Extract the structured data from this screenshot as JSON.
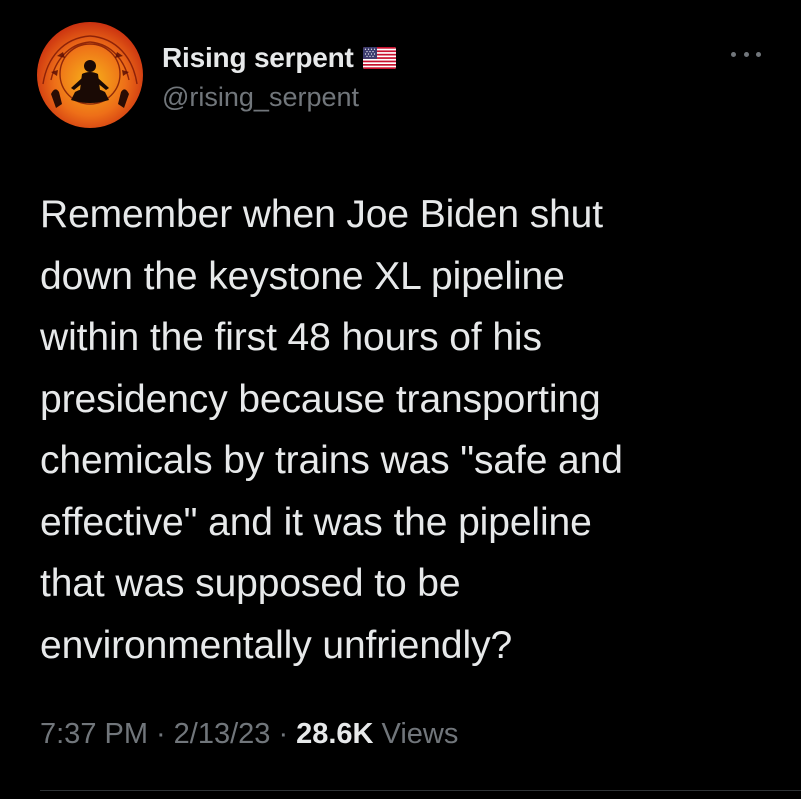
{
  "author": {
    "display_name": "Rising serpent",
    "handle": "@rising_serpent",
    "flag_icon": "us-flag-icon"
  },
  "tweet": {
    "lines": [
      "Remember when Joe Biden shut",
      "down the keystone XL pipeline",
      "within the first 48 hours of his",
      "presidency because transporting",
      "chemicals by trains was \"safe and",
      "effective\" and it was the pipeline",
      "that was supposed to be",
      "environmentally unfriendly?"
    ]
  },
  "meta": {
    "time": "7:37 PM",
    "separator": "·",
    "date": "2/13/23",
    "views_count": "28.6K",
    "views_label": "Views"
  },
  "colors": {
    "background": "#000000",
    "primary_text": "#e7e9ea",
    "secondary_text": "#71767b"
  },
  "icons": {
    "more": "more-options-icon",
    "avatar": "meditating-figure-avatar"
  }
}
